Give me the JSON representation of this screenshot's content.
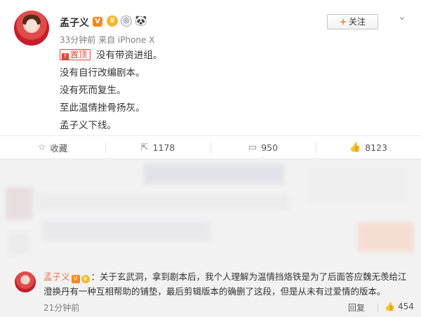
{
  "post": {
    "author": "孟子义",
    "badge_vip": "V",
    "badge_level": "♛",
    "badge_medal": "◎",
    "badge_panda": "🐼",
    "meta": "33分钟前 来自 iPhone X",
    "follow_label": "关注",
    "follow_plus": "+",
    "menu_icon": "⌄",
    "pin_label": "置顶",
    "content_lines": [
      "没有带资进组。",
      "没有自行改编剧本。",
      "没有死而复生。",
      "至此温情挫骨扬灰。",
      "孟子义下线。"
    ]
  },
  "actions": {
    "favorite_label": "收藏",
    "repost_count": "1178",
    "comment_count": "950",
    "like_count": "8123"
  },
  "reply": {
    "author": "孟子义",
    "badge_vip": "V",
    "badge_level": "♛",
    "text": "：关于玄武洞，拿到剧本后，我个人理解为温情挡烙铁是为了后面答应魏无羡给江澄换丹有一种互相帮助的铺垫，最后剪辑版本的确删了这段，但是从未有过爱情的版本。",
    "time": "21分钟前",
    "reply_label": "回复",
    "like_count": "454"
  },
  "colors": {
    "accent_orange": "#eb7350",
    "pin_red": "#e2433b",
    "vip_orange": "#f48a1c"
  }
}
